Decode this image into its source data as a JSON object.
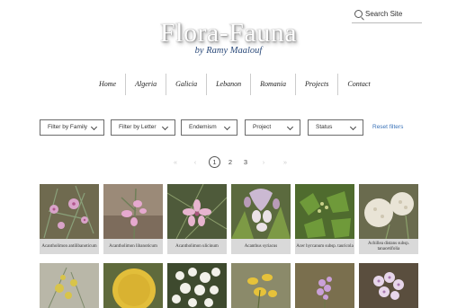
{
  "header": {
    "search_placeholder": "Search Site",
    "title": "Flora-Fauna",
    "subtitle": "by Ramy Maalouf"
  },
  "nav": {
    "items": [
      "Home",
      "Algeria",
      "Galicia",
      "Lebanon",
      "Romania",
      "Projects",
      "Contact"
    ]
  },
  "filters": {
    "dropdowns": [
      "Filter by Family",
      "Filter by Letter",
      "Endemism",
      "Project",
      "Status"
    ],
    "reset_label": "Reset filters"
  },
  "pagination": {
    "first": "«",
    "prev": "‹",
    "pages": [
      "1",
      "2",
      "3"
    ],
    "current": "1",
    "next": "›",
    "last": "»"
  },
  "gallery": {
    "row1": [
      {
        "caption": "Acantholimon antilibanoticum"
      },
      {
        "caption": "Acantholimon libanoticum"
      },
      {
        "caption": "Acantholimon ulicinum"
      },
      {
        "caption": "Acanthus syriacus"
      },
      {
        "caption": "Acer hyrcanum subsp. tauricola"
      },
      {
        "caption": "Achillea distans subsp. tanacetifolia"
      }
    ],
    "row2_count": 6
  },
  "colors": {
    "link": "#3a73b8",
    "subtitle": "#2b4a7a",
    "caption_bg": "#d9d9d9"
  }
}
